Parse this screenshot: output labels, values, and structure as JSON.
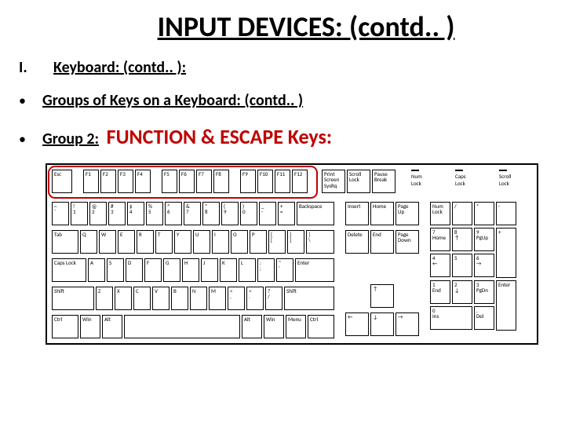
{
  "title": "INPUT DEVICES: (contd.. )",
  "roman": "I.",
  "heading1": "Keyboard: (contd.. ):",
  "bullet1": "Groups of Keys on a Keyboard: (contd.. )",
  "group2_label": "Group 2:",
  "group2_text": "FUNCTION & ESCAPE Keys:",
  "keyboard": {
    "function_row": {
      "esc": "Esc",
      "f": [
        "F1",
        "F2",
        "F3",
        "F4",
        "F5",
        "F6",
        "F7",
        "F8",
        "F9",
        "F10",
        "F11",
        "F12"
      ],
      "sys": [
        "Print\nScreen\nSysRq",
        "Scroll\nLock",
        "Pause\nBreak"
      ]
    },
    "indicators": [
      "Num\nLock",
      "Caps\nLock",
      "Scroll\nLock"
    ],
    "row1": [
      "~\n`",
      "!\n1",
      "@\n2",
      "#\n3",
      "$\n4",
      "%\n5",
      "^\n6",
      "&\n7",
      "*\n8",
      "(\n9",
      ")\n0",
      "_\n-",
      "+\n=",
      "Backspace"
    ],
    "row2": [
      "Tab",
      "Q",
      "W",
      "E",
      "R",
      "T",
      "Y",
      "U",
      "I",
      "O",
      "P",
      "{\n[",
      "}\n]",
      "|\n\\"
    ],
    "row3": [
      "Caps Lock",
      "A",
      "S",
      "D",
      "F",
      "G",
      "H",
      "J",
      "K",
      "L",
      ":\n;",
      "\"\n'",
      "Enter"
    ],
    "row4": [
      "Shift",
      "Z",
      "X",
      "C",
      "V",
      "B",
      "N",
      "M",
      "<\n,",
      ">\n.",
      "?\n/",
      "Shift"
    ],
    "row5": [
      "Ctrl",
      "Win",
      "Alt",
      " ",
      "Alt",
      "Win",
      "Menu",
      "Ctrl"
    ],
    "nav1": [
      "Insert",
      "Home",
      "Page\nUp"
    ],
    "nav2": [
      "Delete",
      "End",
      "Page\nDown"
    ],
    "arrows": {
      "up": "↑",
      "left": "←",
      "down": "↓",
      "right": "→"
    },
    "numpad": {
      "r0": [
        "Num\nLock",
        "/",
        "*",
        "-"
      ],
      "r1": [
        "7\nHome",
        "8\n↑",
        "9\nPgUp"
      ],
      "r2": [
        "4\n←",
        "5",
        "6\n→"
      ],
      "r3": [
        "1\nEnd",
        "2\n↓",
        "3\nPgDn"
      ],
      "r4": [
        "0\nIns",
        ".\nDel"
      ],
      "plus": "+",
      "enter": "Enter"
    }
  }
}
